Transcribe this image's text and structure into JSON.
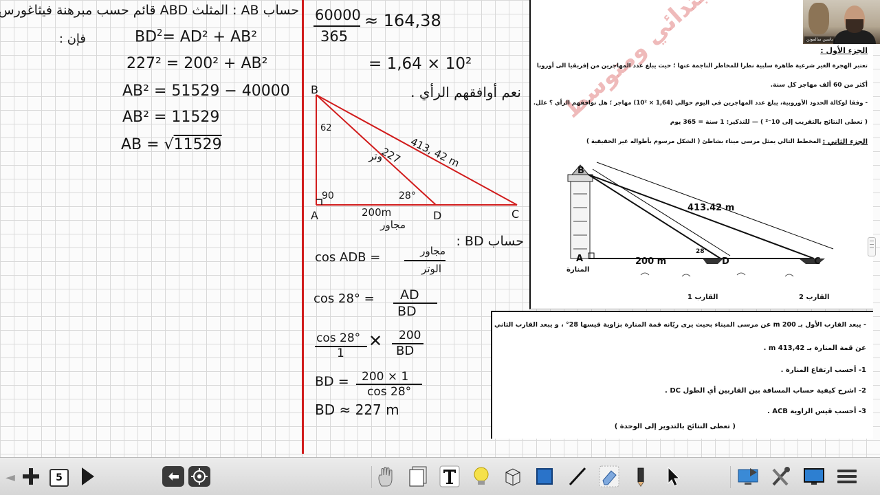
{
  "left_panel": {
    "heading": "حساب AB : المثلث ABD قائم حسب مبرهنة فيثاغورس",
    "then_label": "فإن :",
    "step1_lhs": "BD",
    "step1_rhs": "= AD² + AB²",
    "step2": "227² = 200² + AB²",
    "step3": "AB² = 51529 − 40000",
    "step4": "AB² = 11529",
    "step5_lhs": "AB =",
    "step5_root": "11529"
  },
  "middle_panel": {
    "fraction1_num": "60000",
    "fraction1_den": "365",
    "fraction1_result": "≈ 164,38",
    "sci_result": "= 1,64 × 10²",
    "answer_note": "نعم أوافقهم الرأي .",
    "triangle": {
      "label_B": "B",
      "label_A": "A",
      "label_D": "D",
      "label_C": "C",
      "angle_B": "62",
      "angle_A": "90",
      "angle_D": "28°",
      "hyp_BC": "413, 42 m",
      "seg_BD": "227",
      "seg_BD_word": "وتر",
      "seg_AD": "200m",
      "seg_AD_word": "مجاور"
    },
    "bd_heading": "حساب BD :",
    "cos_line1_lhs": "cos ADB =",
    "cos_line1_num": "مجاور",
    "cos_line1_den": "الوتر",
    "cos_line2_lhs": "cos 28° =",
    "cos_line2_num": "AD",
    "cos_line2_den": "BD",
    "cos_line3_num_left": "cos 28°",
    "cos_line3_den_left": "1",
    "cos_line3_num_right": "200",
    "cos_line3_den_right": "BD",
    "bd_line_lhs": "BD =",
    "bd_line_num": "200 × 1",
    "bd_line_den": "cos 28°",
    "bd_final": "BD ≈ 227 m"
  },
  "exam": {
    "part1_title": "الجزء الأول :",
    "part1_line1": "تعتبر الهجرة الغير شرعية ظاهرة سلبية نظرا للمخاطر الناجمة عنها ؛ حيث يبلغ عدد المهاجرين من إفريقيا الى أوروبا",
    "part1_line2": "أكثر من 60 ألف مهاجر كل سنة.",
    "part1_line3": "- وفقا لوكالة الحدود الأوروبية، يبلغ عدد المهاجرين في اليوم حوالي (1,64 × 10²) مهاجر ؛ هل توافقهم الرأي ؟ علل.",
    "part1_line4": "( تعطى النتائج بالتقريب إلى 10⁻² )     — للتذكير: 1 سنة = 365 يوم",
    "part2_title": "الجزء الثاني :",
    "part2_intro": "المخطط التالي يمثل مرسى ميناء بشاطئ ( الشكل مرسوم بأطواله غير الحقيقية )",
    "fig_B": "B",
    "fig_A": "A",
    "fig_D": "D",
    "fig_C": "C",
    "fig_BC": "413.42 m",
    "fig_AD": "200 m",
    "fig_angle": "28°",
    "fig_lighthouse": "المنارة",
    "fig_boat1": "القارب 1",
    "fig_boat2": "القارب 2",
    "watermark": "دروس الاستاذ ياسين ابتدائي ومتوسط",
    "part2_line1": "- يبعد القارب الأول بـ 200 m عن مرسى الميناء بحيث يرى ربّانه قمة المنارة بزاوية قيسها 28° ، و يبعد القارب الثاني",
    "part2_line2": "عن قمة المنارة بـ 413,42 m .",
    "q1": "1- أحسب ارتفاع المنارة .",
    "q2": "2- اشرح كيفية حساب المسافة بين القاربين أي الطول DC .",
    "q3": "3- أحسب قيس الزاوية ACB .",
    "note": "( تعطى النتائج بالتدوير إلى الوحدة )"
  },
  "webcam": {
    "label": "ياسين سالمونن"
  },
  "toolbar": {
    "page_number": "5",
    "left_arrow": "◄",
    "tools": [
      "add-page",
      "page-selector",
      "next-page",
      "undo",
      "screen-capture",
      "hand-tool",
      "page-sorter",
      "text-tool",
      "highlighter",
      "3d-tool",
      "shape-tool",
      "line-tool",
      "eraser-tool",
      "pen-tool",
      "select-tool",
      "screen-share",
      "settings-tool",
      "display-tool",
      "menu"
    ]
  }
}
